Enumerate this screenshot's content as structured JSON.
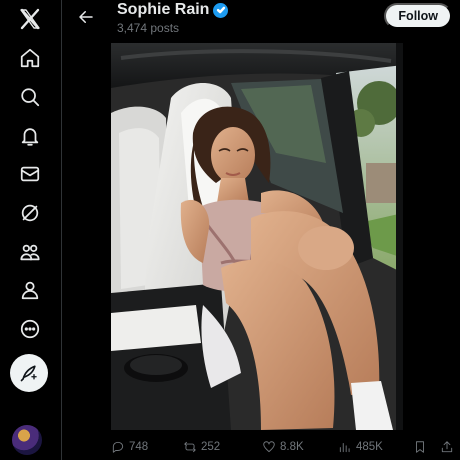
{
  "nav": {
    "items": [
      "logo-icon",
      "home-icon",
      "search-icon",
      "notifications-icon",
      "messages-icon",
      "grok-icon",
      "communities-icon",
      "profile-icon",
      "more-icon"
    ],
    "compose": "compose-icon"
  },
  "header": {
    "name": "Sophie Rain",
    "posts_count": "3,474 posts",
    "follow_label": "Follow",
    "verified_color": "#1d9bf0"
  },
  "post_actions": {
    "replies": "748",
    "reposts": "252",
    "likes": "8.8K",
    "views": "485K"
  },
  "theme": {
    "background": "#000000",
    "text": "#e7e9ea",
    "muted": "#71767b",
    "accent": "#1d9bf0"
  }
}
